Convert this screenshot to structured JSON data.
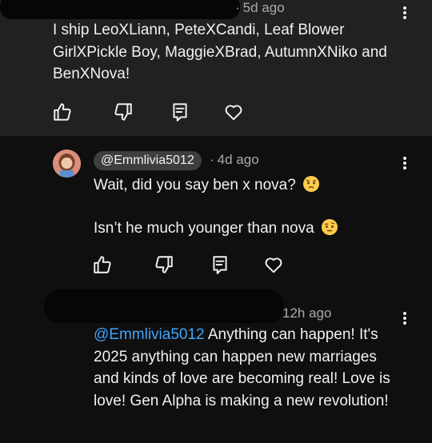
{
  "comments": [
    {
      "time": "5d ago",
      "text": "I ship LeoXLiann, PeteXCandi, Leaf Blower GirlXPickle Boy, MaggieXBrad,  AutumnXNiko and BenXNova!"
    },
    {
      "handle": "@Emmlivia5012",
      "time": "4d ago",
      "line1": "Wait, did you say ben x nova?",
      "line2": "Isn’t he much younger than nova",
      "emoji1": "worried-face",
      "emoji2": "face-with-raised-eyebrow"
    },
    {
      "time": "12h ago",
      "mention": "@Emmlivia5012",
      "text": " Anything can happen! It's 2025 anything can happen new marriages and kinds of love are becoming real! Love is love! Gen Alpha is making a new revolution!"
    }
  ],
  "icons": [
    "like-icon",
    "dislike-icon",
    "reply-icon",
    "heart-icon",
    "more-vert-icon"
  ],
  "colors": {
    "bg": "#0f0f0f",
    "card": "#212121",
    "text": "#f1f1f1",
    "meta": "#aaaaaa",
    "mention": "#3ea6ff",
    "pill": "#3e3e3e"
  }
}
